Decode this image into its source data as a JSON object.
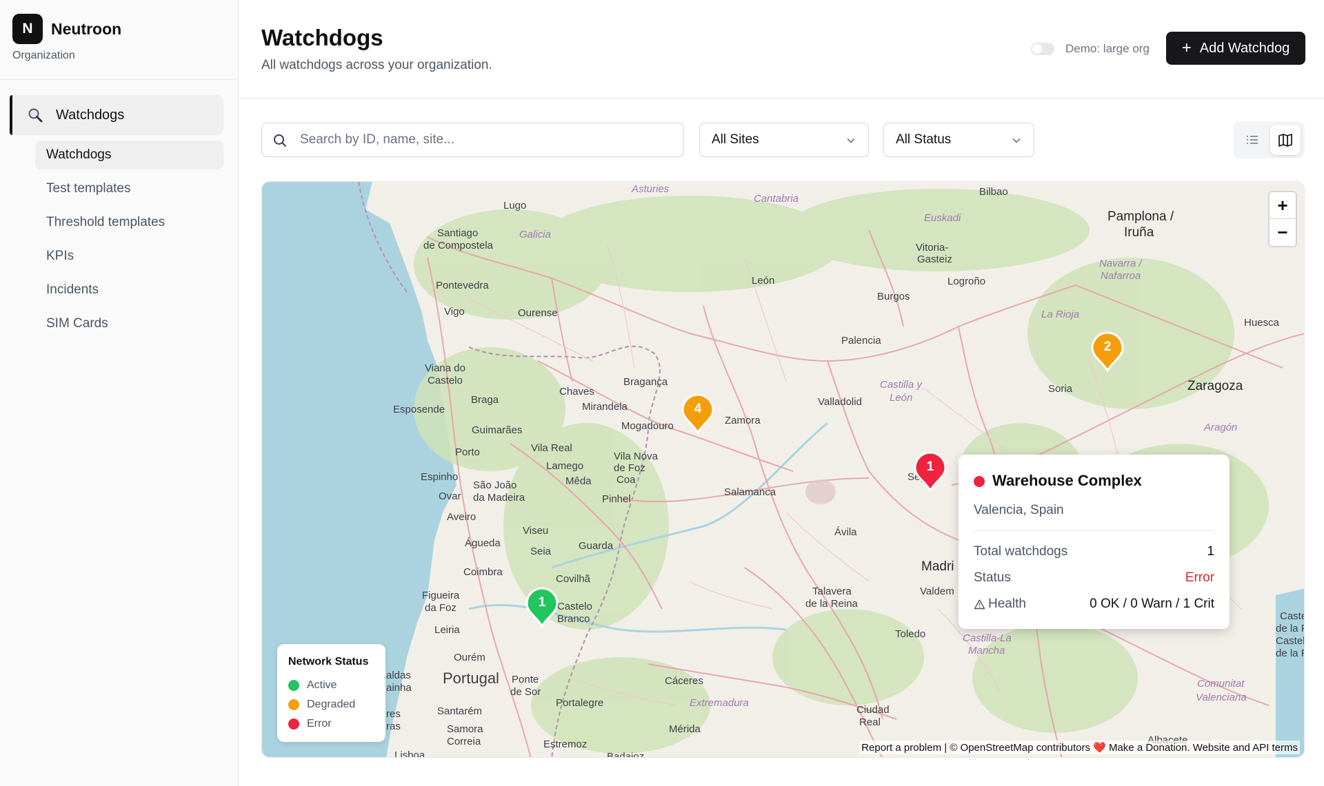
{
  "brand": {
    "logo_letter": "N",
    "name": "Neutroon",
    "subtitle": "Organization"
  },
  "sidebar": {
    "group_label": "Watchdogs",
    "items": [
      {
        "label": "Watchdogs",
        "active": true
      },
      {
        "label": "Test templates",
        "active": false
      },
      {
        "label": "Threshold templates",
        "active": false
      },
      {
        "label": "KPIs",
        "active": false
      },
      {
        "label": "Incidents",
        "active": false
      },
      {
        "label": "SIM Cards",
        "active": false
      }
    ]
  },
  "header": {
    "title": "Watchdogs",
    "subtitle": "All watchdogs across your organization.",
    "demo_toggle_label": "Demo: large org",
    "demo_toggle_on": false,
    "add_button_label": "Add Watchdog"
  },
  "filters": {
    "search_placeholder": "Search by ID, name, site...",
    "search_value": "",
    "site_select": "All Sites",
    "status_select": "All Status"
  },
  "view_toggle": {
    "active": "map"
  },
  "map": {
    "places": {
      "asturies": "Asturies",
      "cantabria": "Cantabria",
      "bilbao": "Bilbao",
      "lugo": "Lugo",
      "santiago1": "Santiago",
      "santiago2": "de Compostela",
      "galicia": "Galicia",
      "euskadi": "Euskadi",
      "pamplona1": "Pamplona /",
      "pamplona2": "Iruña",
      "vitoria1": "Vitoria-",
      "vitoria2": "Gasteiz",
      "navarra1": "Navarra /",
      "navarra2": "Nafarroa",
      "leon": "León",
      "logrono": "Logroño",
      "pontevedra": "Pontevedra",
      "burgos": "Burgos",
      "vigo": "Vigo",
      "ourense": "Ourense",
      "larioja": "La Rioja",
      "huesca": "Huesca",
      "palencia": "Palencia",
      "viana1": "Viana do",
      "viana2": "Castelo",
      "braganca": "Bragança",
      "castilla1": "Castilla y",
      "castilla2": "León",
      "chaves": "Chaves",
      "braga": "Braga",
      "soria": "Soria",
      "zaragoza": "Zaragoza",
      "valladolid": "Valladolid",
      "esposende": "Esposende",
      "mirandela": "Mirandela",
      "zamora": "Zamora",
      "mogadouro": "Mogadouro",
      "guimaraes": "Guimarães",
      "aragon": "Aragón",
      "vilareal": "Vila Real",
      "porto": "Porto",
      "vilanova1": "Vila Nova",
      "vilanova2": "de Foz",
      "vilanova3": "Coa",
      "lamego": "Lamego",
      "espinho": "Espinho",
      "meda": "Mêda",
      "segovia": "Segov",
      "saojoao1": "São João",
      "saojoao2": "da Madeira",
      "ovar": "Ovar",
      "salamanca": "Salamanca",
      "pinhel": "Pinhel",
      "aveiro": "Aveiro",
      "viseu": "Viseu",
      "avila": "Ávila",
      "agueda": "Águeda",
      "seia": "Seia",
      "guarda": "Guarda",
      "madrid": "Madri",
      "coimbra": "Coimbra",
      "covilha": "Covilhã",
      "figueira1": "Figueira",
      "figueira2": "da Foz",
      "castelo1": "Castelo",
      "castelo2": "Branco",
      "talavera1": "Talavera",
      "talavera2": "de la Reina",
      "valdemoro": "Valdem",
      "leiria": "Leiria",
      "toledo": "Toledo",
      "castillalm1": "Castilla-La",
      "castillalm2": "Mancha",
      "ourem": "Ourém",
      "portugal": "Portugal",
      "ponte1": "Ponte",
      "ponte2": "de Sor",
      "caceres": "Cáceres",
      "caldas1": "aldas",
      "caldas2": "ainha",
      "portalegre": "Portalegre",
      "extremadura": "Extremadura",
      "comunitat1": "Comunitat",
      "comunitat2": "Valenciana",
      "santarem": "Santarém",
      "ciudadreal1": "Ciudad",
      "ciudadreal2": "Real",
      "samora1": "Samora",
      "samora2": "Correia",
      "merida": "Mérida",
      "estremoz": "Estremoz",
      "torres1": "res",
      "torres2": "ras",
      "lisboa": "Lisboa",
      "albacete": "Albacete",
      "castelle1": "Caste",
      "castelle2": "de la Pl",
      "castelle3": "Castel",
      "castelle4": "de la P",
      "badajoz": "Badajoz",
      "de": "de"
    },
    "clusters": [
      {
        "label": "2",
        "status": "degraded",
        "color": "#f59e0b"
      },
      {
        "label": "4",
        "status": "degraded",
        "color": "#f59e0b"
      },
      {
        "label": "1",
        "status": "error",
        "color": "#ef233c"
      },
      {
        "label": "1",
        "status": "active",
        "color": "#22c55e"
      }
    ],
    "popup": {
      "title": "Warehouse Complex",
      "location": "Valencia, Spain",
      "status_color": "#ef233c",
      "total_label": "Total watchdogs",
      "total_value": "1",
      "status_label": "Status",
      "status_value": "Error",
      "health_label": "Health",
      "health_value": "0 OK / 0 Warn / 1 Crit"
    },
    "legend": {
      "title": "Network Status",
      "items": [
        {
          "label": "Active",
          "color": "#22c55e"
        },
        {
          "label": "Degraded",
          "color": "#f59e0b"
        },
        {
          "label": "Error",
          "color": "#ef233c"
        }
      ]
    },
    "zoom_in": "+",
    "zoom_out": "−",
    "attribution": "Report a problem | © OpenStreetMap contributors ❤️ Make a Donation. Website and API terms"
  }
}
